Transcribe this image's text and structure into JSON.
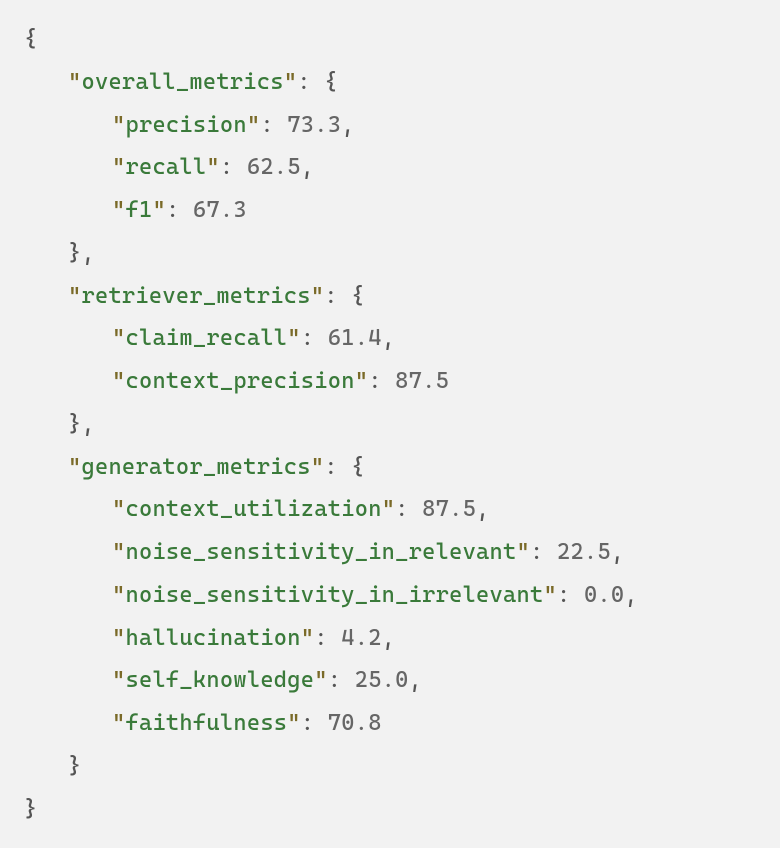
{
  "json_content": {
    "overall_metrics": {
      "precision": 73.3,
      "recall": 62.5,
      "f1": 67.3
    },
    "retriever_metrics": {
      "claim_recall": 61.4,
      "context_precision": 87.5
    },
    "generator_metrics": {
      "context_utilization": 87.5,
      "noise_sensitivity_in_relevant": 22.5,
      "noise_sensitivity_in_irrelevant": 0.0,
      "hallucination": 4.2,
      "self_knowledge": 25.0,
      "faithfulness": 70.8
    }
  },
  "tokens": {
    "open_brace": "{",
    "close_brace": "}",
    "close_brace_comma": "},",
    "quote": "\"",
    "colon_space": ": ",
    "comma": ","
  },
  "keys": {
    "overall_metrics": "overall_metrics",
    "precision": "precision",
    "recall": "recall",
    "f1": "f1",
    "retriever_metrics": "retriever_metrics",
    "claim_recall": "claim_recall",
    "context_precision": "context_precision",
    "generator_metrics": "generator_metrics",
    "context_utilization": "context_utilization",
    "noise_sensitivity_in_relevant": "noise_sensitivity_in_relevant",
    "noise_sensitivity_in_irrelevant": "noise_sensitivity_in_irrelevant",
    "hallucination": "hallucination",
    "self_knowledge": "self_knowledge",
    "faithfulness": "faithfulness"
  },
  "values_fmt": {
    "precision": "73.3",
    "recall": "62.5",
    "f1": "67.3",
    "claim_recall": "61.4",
    "context_precision": "87.5",
    "context_utilization": "87.5",
    "noise_sensitivity_in_relevant": "22.5",
    "noise_sensitivity_in_irrelevant": "0.0",
    "hallucination": "4.2",
    "self_knowledge": "25.0",
    "faithfulness": "70.8"
  }
}
